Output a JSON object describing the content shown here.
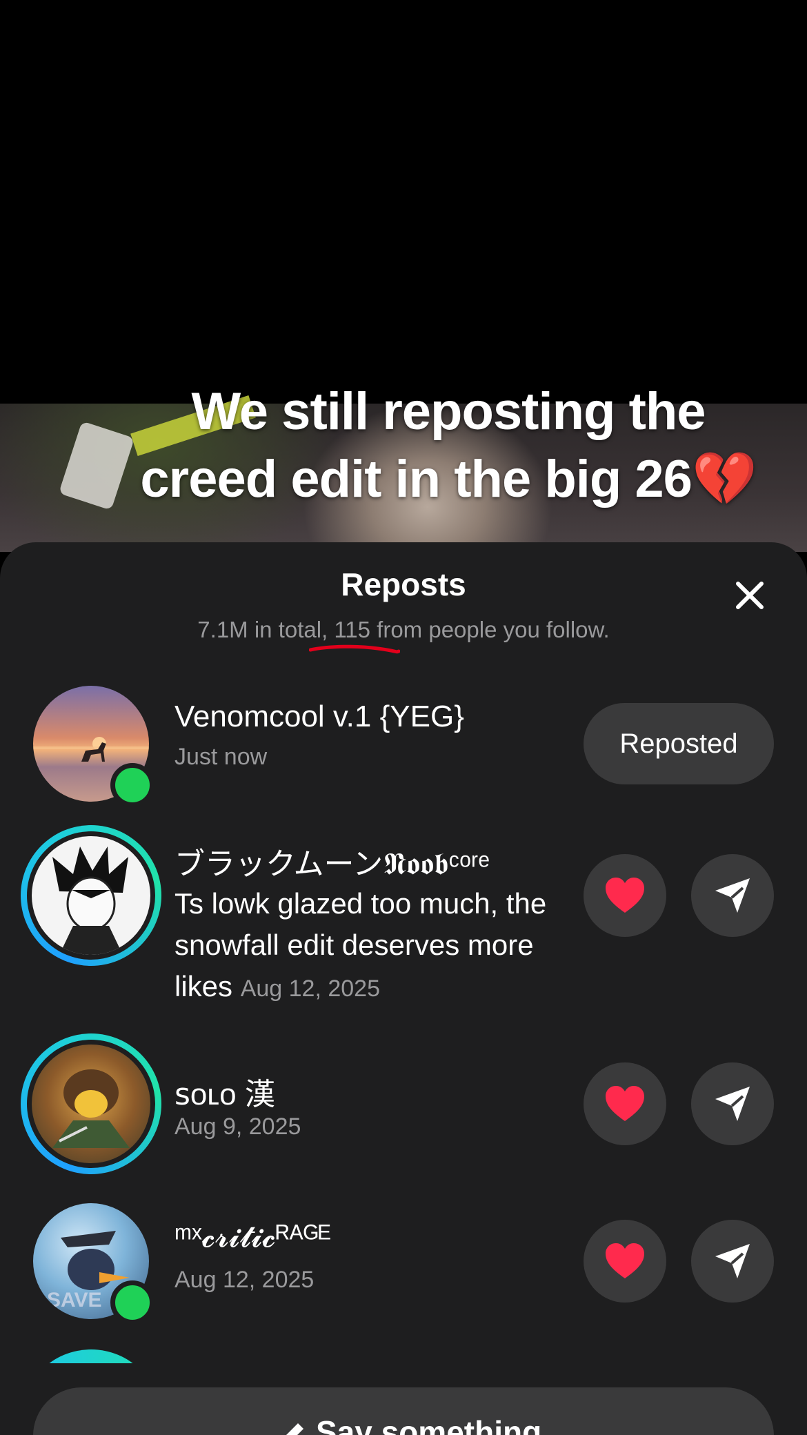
{
  "video": {
    "caption_line1": "We still reposting the",
    "caption_line2": "creed edit in the big 26💔"
  },
  "sheet": {
    "title": "Reposts",
    "subtitle": "7.1M in total, 115 from people you follow.",
    "close_icon": "close-icon"
  },
  "reposts": [
    {
      "name": "Venomcool v.1 {YEG}",
      "meta": "Just now",
      "action": "Reposted",
      "online": true,
      "story_ring": false
    },
    {
      "name": "ブラックムーン𝕹𝖔𝖔𝖇ᶜᵒʳᵉ",
      "comment": "Ts lowk glazed too much, the snowfall edit deserves more likes",
      "date": "Aug 12, 2025",
      "story_ring": true,
      "online": false
    },
    {
      "name": "ꜱᴏʟᴏ 漢",
      "meta": "Aug 9, 2025",
      "story_ring": true,
      "online": false
    },
    {
      "name": "ᵐˣ𝓬𝓻𝓲𝓽𝓲𝓬ᴿᴬᴳᴱ",
      "meta": "Aug 12, 2025",
      "story_ring": false,
      "online": true
    }
  ],
  "actions": {
    "like_icon": "heart-icon",
    "send_icon": "send-icon"
  },
  "bottom_bar": {
    "label": "Say something...",
    "icon": "pencil-icon"
  },
  "colors": {
    "sheet_bg": "#1e1e1f",
    "button_bg": "#3a3a3b",
    "like_red": "#ff2a4d",
    "online_green": "#1fd157",
    "muted_text": "#9a9a9c",
    "annotation_red": "#e3001b"
  }
}
